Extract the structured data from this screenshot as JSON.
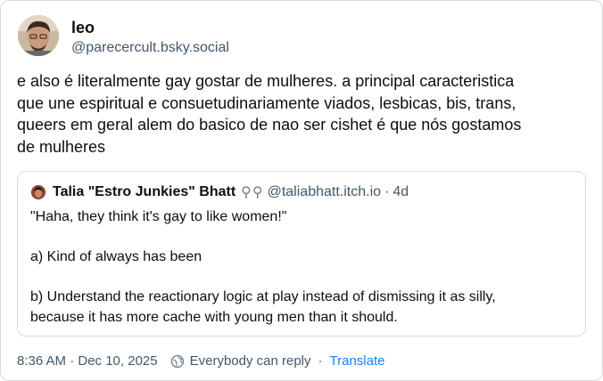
{
  "post": {
    "author_name": "leo",
    "author_handle": "@parecercult.bsky.social",
    "text": "e also é literalmente gay gostar de mulheres. a principal caracteristica\nque une espiritual e consuetudinariamente viados, lesbicas, bis, trans,\nqueers em geral alem do basico de nao ser cishet é que nós gostamos\nde mulheres"
  },
  "quote": {
    "author_name": "Talia \"Estro Junkies\" Bhatt",
    "author_symbols": "⚲⚲",
    "author_handle": "@taliabhatt.itch.io",
    "dot": "·",
    "time": "4d",
    "text": "\"Haha, they think it's gay to like women!\"\n\na) Kind of always has been\n\nb) Understand the reactionary logic at play instead of dismissing it as silly,\nbecause it has more cache with young men than it should."
  },
  "footer": {
    "timestamp": "8:36 AM · Dec 10, 2025",
    "reply_setting": "Everybody can reply",
    "separator": "·",
    "translate_label": "Translate"
  },
  "icons": {
    "avatar": "user-avatar",
    "quote_avatar": "quote-author-avatar",
    "reply_icon": "globe-reply-icon"
  },
  "colors": {
    "text": "#0b0f14",
    "muted": "#42576c",
    "border": "#d4dbe2",
    "link": "#1083fe"
  }
}
